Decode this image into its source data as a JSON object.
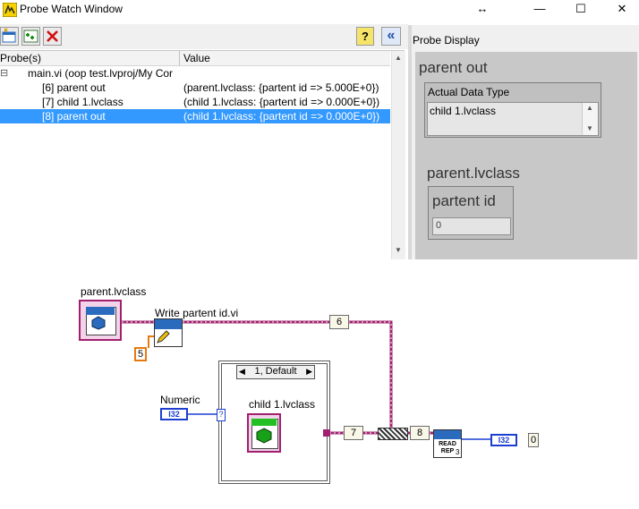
{
  "window": {
    "title": "Probe Watch Window",
    "controls": {
      "move": "↔",
      "minimize": "—",
      "maximize": "☐",
      "close": "✕"
    }
  },
  "toolbar": {
    "buttons": [
      "new-probe-icon",
      "add-probe-icon",
      "delete-probe-icon"
    ],
    "help": "?",
    "collapse": "«"
  },
  "probe_list": {
    "columns": [
      "Probe(s)",
      "Value"
    ],
    "rows": [
      {
        "probe": "main.vi (oop test.lvproj/My Cor",
        "value": "",
        "expander": "⊟",
        "selected": false
      },
      {
        "probe": "[6] parent out",
        "value": "(parent.lvclass: {partent id => 5.000E+0})",
        "selected": false
      },
      {
        "probe": "[7] child 1.lvclass",
        "value": "(child 1.lvclass: {partent id => 0.000E+0})",
        "selected": false
      },
      {
        "probe": "[8] parent out",
        "value": "(child 1.lvclass: {partent id => 0.000E+0})",
        "selected": true
      }
    ]
  },
  "probe_display": {
    "label": "Probe Display",
    "indicator_label": "parent out",
    "actual_type_label": "Actual Data Type",
    "actual_type_value": "child 1.lvclass",
    "cluster_label": "parent.lvclass",
    "field_label": "partent id",
    "field_value": "0"
  },
  "diagram": {
    "parent_class_label": "parent.lvclass",
    "write_vi_label": "Write partent id.vi",
    "const_5": "5",
    "probe_6": "6",
    "case_selector": "1, Default",
    "numeric_label": "Numeric",
    "numeric_type": "I32",
    "selector_term": "?",
    "child_class_label": "child 1.lvclass",
    "probe_7": "7",
    "probe_8": "8",
    "read_rep_label": "READ REP",
    "read_rep_num": "3",
    "out_type": "I32",
    "out_value": "0"
  },
  "colors": {
    "class_wire": "#a0206e",
    "selection": "#3399ff",
    "int_wire": "#1c3fcf",
    "const_orange": "#e87810"
  }
}
